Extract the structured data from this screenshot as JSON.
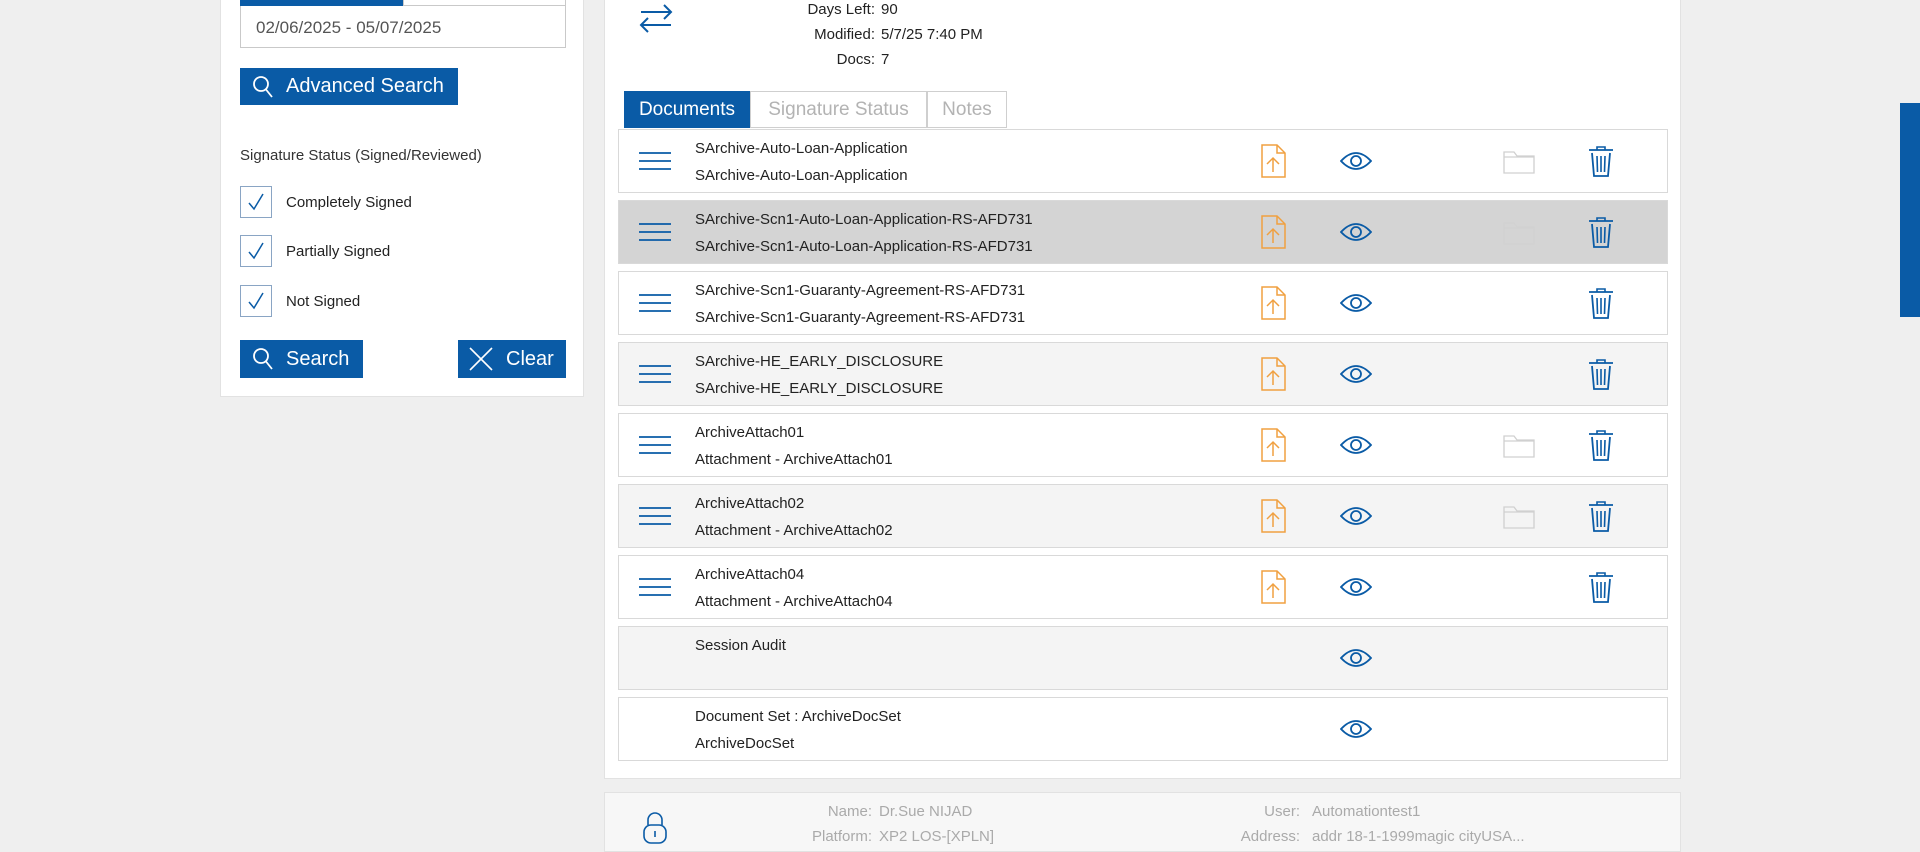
{
  "colors": {
    "accent": "#0a5ba6",
    "upload": "#f0a040",
    "row_alt": "#f4f4f4",
    "row_highlight": "#d4d4d4"
  },
  "filters": {
    "date_range_value": "02/06/2025 - 05/07/2025",
    "advanced_search_label": "Advanced Search",
    "signature_status_heading": "Signature Status (Signed/Reviewed)",
    "checkboxes": [
      {
        "label": "Completely Signed",
        "checked": true
      },
      {
        "label": "Partially Signed",
        "checked": true
      },
      {
        "label": "Not Signed",
        "checked": true
      }
    ],
    "search_label": "Search",
    "clear_label": "Clear"
  },
  "summary": {
    "days_left_label": "Days Left:",
    "days_left_value": "90",
    "modified_label": "Modified:",
    "modified_value": "5/7/25 7:40 PM",
    "docs_label": "Docs:",
    "docs_value": "7"
  },
  "tabs": [
    {
      "label": "Documents",
      "active": true
    },
    {
      "label": "Signature Status",
      "active": false
    },
    {
      "label": "Notes",
      "active": false
    }
  ],
  "documents": [
    {
      "line1": "SArchive-Auto-Loan-Application",
      "line2": "SArchive-Auto-Loan-Application",
      "menu": true,
      "upload": true,
      "folder": true,
      "delete": true,
      "style": "normal"
    },
    {
      "line1": "SArchive-Scn1-Auto-Loan-Application-RS-AFD731",
      "line2": "SArchive-Scn1-Auto-Loan-Application-RS-AFD731",
      "menu": true,
      "upload": true,
      "folder": true,
      "delete": true,
      "style": "highlight"
    },
    {
      "line1": "SArchive-Scn1-Guaranty-Agreement-RS-AFD731",
      "line2": "SArchive-Scn1-Guaranty-Agreement-RS-AFD731",
      "menu": true,
      "upload": true,
      "folder": false,
      "delete": true,
      "style": "normal"
    },
    {
      "line1": "SArchive-HE_EARLY_DISCLOSURE",
      "line2": "SArchive-HE_EARLY_DISCLOSURE",
      "menu": true,
      "upload": true,
      "folder": false,
      "delete": true,
      "style": "alt"
    },
    {
      "line1": "ArchiveAttach01",
      "line2": "Attachment - ArchiveAttach01",
      "menu": true,
      "upload": true,
      "folder": true,
      "delete": true,
      "style": "normal"
    },
    {
      "line1": "ArchiveAttach02",
      "line2": "Attachment - ArchiveAttach02",
      "menu": true,
      "upload": true,
      "folder": true,
      "delete": true,
      "style": "alt"
    },
    {
      "line1": "ArchiveAttach04",
      "line2": "Attachment - ArchiveAttach04",
      "menu": true,
      "upload": true,
      "folder": false,
      "delete": true,
      "style": "normal"
    },
    {
      "line1": "Session Audit",
      "line2": "",
      "menu": false,
      "upload": false,
      "folder": false,
      "delete": false,
      "style": "alt"
    },
    {
      "line1": "Document Set : ArchiveDocSet",
      "line2": "ArchiveDocSet",
      "menu": false,
      "upload": false,
      "folder": false,
      "delete": false,
      "style": "normal"
    }
  ],
  "footer": {
    "name_label": "Name:",
    "name_value": "Dr.Sue NIJAD",
    "platform_label": "Platform:",
    "platform_value": "XP2 LOS-[XPLN]",
    "user_label": "User:",
    "user_value": "Automationtest1",
    "address_label": "Address:",
    "address_value": "addr 18-1-1999magic cityUSA..."
  },
  "icons": {
    "swap": "swap-arrows-icon",
    "lock": "lock-icon",
    "menu": "hamburger-menu-icon",
    "upload": "file-upload-icon",
    "view": "eye-icon",
    "folder": "folder-icon",
    "delete": "trash-icon",
    "search": "search-icon",
    "clear": "close-icon",
    "check": "check-icon"
  }
}
